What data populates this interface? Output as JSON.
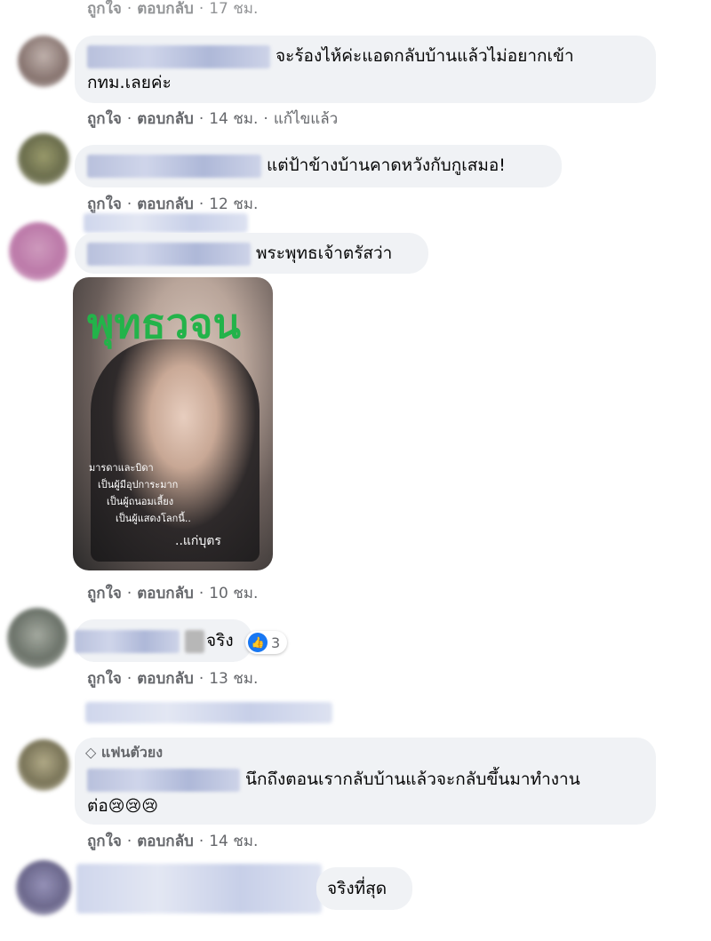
{
  "top_partial": {
    "time": "17 ชม."
  },
  "actions_labels": {
    "like": "ถูกใจ",
    "reply": "ตอบกลับ",
    "edited": "แก้ไขแล้ว"
  },
  "comments": [
    {
      "text": "จะร้องไห้ค่ะแอดกลับบ้านแล้วไม่อยากเข้า",
      "text2": "กทม.เลยค่ะ",
      "time": "14 ชม."
    },
    {
      "text": "แต่ป้าข้างบ้านคาดหวังกับกูเสมอ!",
      "time": "12 ชม."
    },
    {
      "text": "พระพุทธเจ้าตรัสว่า",
      "time": "10 ชม.",
      "image": {
        "title": "พุทธวจน",
        "verse": [
          "มารดาและบิดา",
          "เป็นผู้มีอุปการะมาก",
          "เป็นผู้ถนอมเลี้ยง",
          "เป็นผู้แสดงโลกนี้.."
        ],
        "sign": "..แก่บุตร"
      }
    },
    {
      "text": "จริง",
      "time": "13 ชม.",
      "reaction": {
        "icon": "like-icon",
        "count": "3"
      }
    },
    {
      "badge": "แฟนตัวยง",
      "text": "นึกถึงตอนเรากลับบ้านแล้วจะกลับขึ้นมาทำงาน",
      "text2": "ต่อ",
      "emoji": "😢😢😢",
      "time": "14 ชม."
    },
    {
      "text": "จริงที่สุด"
    }
  ],
  "colors": {
    "bubble": "#f0f2f5",
    "meta": "#65676b",
    "like_blue": "#1877f2",
    "title_green": "#23b34a"
  }
}
